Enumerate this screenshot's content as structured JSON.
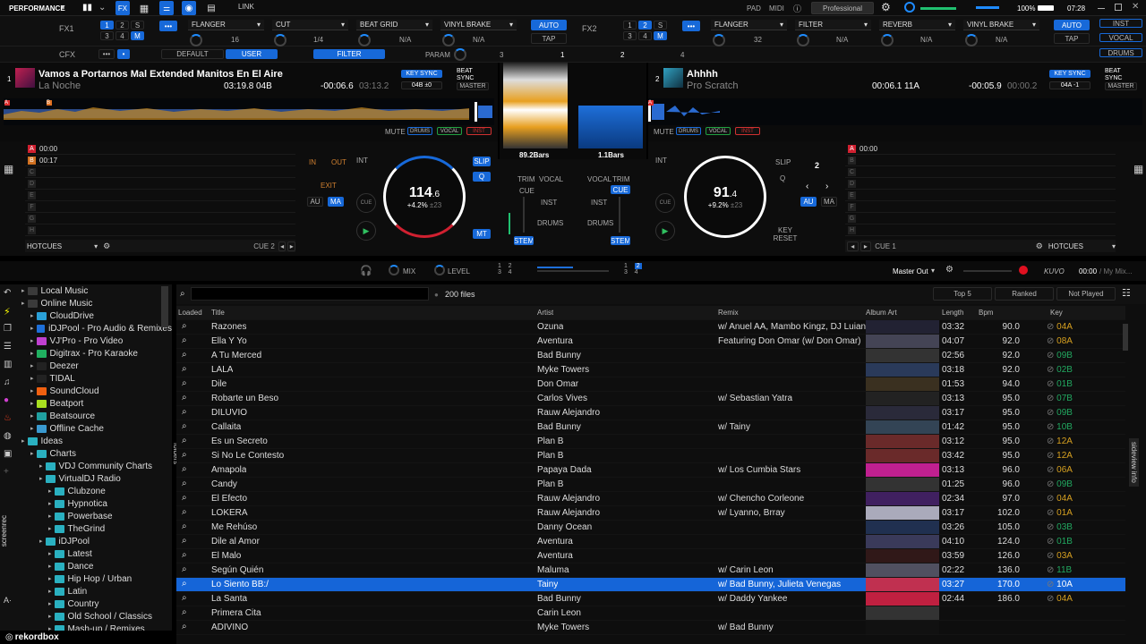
{
  "topbar": {
    "layout": "PERFORMANCE",
    "link": "LINK",
    "pad": "PAD",
    "midi": "MIDI",
    "license": "Professional",
    "volume": "100%",
    "time": "07:28"
  },
  "fx1": {
    "label": "FX1",
    "nums": [
      "1",
      "2",
      "S",
      "3",
      "4",
      "M"
    ],
    "effects": [
      "FLANGER",
      "CUT",
      "BEAT GRID",
      "VINYL BRAKE"
    ],
    "vals": [
      "16",
      "1/4",
      "N/A",
      "N/A"
    ],
    "auto": "AUTO",
    "tap": "TAP"
  },
  "fx2": {
    "label": "FX2",
    "nums": [
      "1",
      "2",
      "S",
      "3",
      "4",
      "M"
    ],
    "effects": [
      "FLANGER",
      "FILTER",
      "REVERB",
      "VINYL BRAKE"
    ],
    "vals": [
      "32",
      "N/A",
      "N/A",
      "N/A"
    ],
    "auto": "AUTO",
    "tap": "TAP"
  },
  "stems": [
    "INST",
    "VOCAL",
    "DRUMS"
  ],
  "cfx": {
    "label": "CFX",
    "default": "DEFAULT",
    "user": "USER",
    "filter": "FILTER",
    "param": "PARAM",
    "n1": "3",
    "n2": "1",
    "n3": "2",
    "n4": "4"
  },
  "deck1": {
    "num": "1",
    "title": "Vamos a Portarnos Mal Extended Manitos En El Aire",
    "artist": "La Noche",
    "time": "03:19.8",
    "key": "04B",
    "remain": "-00:06.6",
    "total": "03:13.2",
    "keysync": "KEY SYNC",
    "beatsync": "BEAT SYNC",
    "keyval": "04B ±0",
    "master": "MASTER",
    "mute": "MUTE",
    "drums": "DRUMS",
    "vocal": "VOCAL",
    "inst": "INST",
    "bpm": "114",
    "bpmdec": ".6",
    "pitch": "+4.2%",
    "range": "±23",
    "hotcues": [
      {
        "k": "A",
        "t": "00:00"
      },
      {
        "k": "B",
        "t": "00:17"
      },
      {
        "k": "C",
        "t": ""
      },
      {
        "k": "D",
        "t": ""
      },
      {
        "k": "E",
        "t": ""
      },
      {
        "k": "F",
        "t": ""
      },
      {
        "k": "G",
        "t": ""
      },
      {
        "k": "H",
        "t": ""
      }
    ],
    "hotcue_label": "HOTCUES",
    "cue2": "CUE 2",
    "int": "INT",
    "in": "IN",
    "out": "OUT",
    "exit": "EXIT",
    "au": "AU",
    "ma": "MA",
    "cue": "CUE",
    "slip": "SLIP",
    "q": "Q",
    "mt": "MT"
  },
  "deck2": {
    "num": "2",
    "title": "Ahhhh",
    "artist": "Pro Scratch",
    "time": "00:06.1",
    "key": "11A",
    "remain": "-00:05.9",
    "total": "00:00.2",
    "keysync": "KEY SYNC",
    "beatsync": "BEAT SYNC",
    "keyval": "04A -1",
    "master": "MASTER",
    "mute": "MUTE",
    "drums": "DRUMS",
    "vocal": "VOCAL",
    "inst": "INST",
    "bpm": "91",
    "bpmdec": ".4",
    "pitch": "+9.2%",
    "range": "±23",
    "hotcues": [
      {
        "k": "A",
        "t": "00:00"
      },
      {
        "k": "B",
        "t": ""
      },
      {
        "k": "C",
        "t": ""
      },
      {
        "k": "D",
        "t": ""
      },
      {
        "k": "E",
        "t": ""
      },
      {
        "k": "F",
        "t": ""
      },
      {
        "k": "G",
        "t": ""
      },
      {
        "k": "H",
        "t": ""
      }
    ],
    "hotcue_label": "HOTCUES",
    "cue1": "CUE 1",
    "int": "INT",
    "slip": "SLIP",
    "q": "Q",
    "two": "2",
    "au": "AU",
    "ma": "MA",
    "cue": "CUE",
    "keyreset": "KEY RESET"
  },
  "mixer": {
    "bars1": "89.2Bars",
    "bars2": "1.1Bars",
    "trim": "TRIM",
    "vocal": "VOCAL",
    "cue": "CUE",
    "inst": "INST",
    "drums": "DRUMS",
    "stem": "STEM"
  },
  "midbar": {
    "mix": "MIX",
    "level": "LEVEL",
    "master_out": "Master Out",
    "kuvo": "KUVO",
    "rec_time": "00:00",
    "mymix": "/ My Mix..."
  },
  "tree": [
    {
      "label": "Local Music",
      "lvl": 0,
      "c": "#3a3a3a"
    },
    {
      "label": "Online Music",
      "lvl": 0,
      "c": "#3a3a3a"
    },
    {
      "label": "CloudDrive",
      "lvl": 1,
      "c": "#2aa0d8"
    },
    {
      "label": "iDJPool - Pro Audio & Remixes",
      "lvl": 1,
      "c": "#1e6fd9"
    },
    {
      "label": "VJ'Pro - Pro Video",
      "lvl": 1,
      "c": "#c040d0"
    },
    {
      "label": "Digitrax - Pro Karaoke",
      "lvl": 1,
      "c": "#20b060"
    },
    {
      "label": "Deezer",
      "lvl": 1,
      "c": "#222"
    },
    {
      "label": "TIDAL",
      "lvl": 1,
      "c": "#222"
    },
    {
      "label": "SoundCloud",
      "lvl": 1,
      "c": "#f06010"
    },
    {
      "label": "Beatport",
      "lvl": 1,
      "c": "#a8e020"
    },
    {
      "label": "Beatsource",
      "lvl": 1,
      "c": "#20a0a0"
    },
    {
      "label": "Offline Cache",
      "lvl": 1,
      "c": "#3a9ad0"
    },
    {
      "label": "Ideas",
      "lvl": 0,
      "c": "#2ab0c0"
    },
    {
      "label": "Charts",
      "lvl": 1,
      "c": "#2ab0c0"
    },
    {
      "label": "VDJ Community Charts",
      "lvl": 2,
      "c": "#2ab0c0"
    },
    {
      "label": "VirtualDJ Radio",
      "lvl": 2,
      "c": "#2ab0c0"
    },
    {
      "label": "Clubzone",
      "lvl": 3,
      "c": "#2ab0c0"
    },
    {
      "label": "Hypnotica",
      "lvl": 3,
      "c": "#2ab0c0"
    },
    {
      "label": "Powerbase",
      "lvl": 3,
      "c": "#2ab0c0"
    },
    {
      "label": "TheGrind",
      "lvl": 3,
      "c": "#2ab0c0"
    },
    {
      "label": "iDJPool",
      "lvl": 2,
      "c": "#2ab0c0"
    },
    {
      "label": "Latest",
      "lvl": 3,
      "c": "#2ab0c0"
    },
    {
      "label": "Dance",
      "lvl": 3,
      "c": "#2ab0c0"
    },
    {
      "label": "Hip Hop / Urban",
      "lvl": 3,
      "c": "#2ab0c0"
    },
    {
      "label": "Latin",
      "lvl": 3,
      "c": "#2ab0c0"
    },
    {
      "label": "Country",
      "lvl": 3,
      "c": "#2ab0c0"
    },
    {
      "label": "Old School / Classics",
      "lvl": 3,
      "c": "#2ab0c0"
    },
    {
      "label": "Mash-up / Remixes",
      "lvl": 3,
      "c": "#2ab0c0"
    }
  ],
  "browser": {
    "files": "200 files",
    "top5": "Top 5",
    "ranked": "Ranked",
    "notplayed": "Not Played",
    "folders": "folders",
    "sideview": "sideview info",
    "cols": [
      "Loaded",
      "Title",
      "Artist",
      "Remix",
      "Album Art",
      "Length",
      "Bpm",
      "Key"
    ],
    "rows": [
      [
        "Razones",
        "Ozuna",
        "w/ Anuel AA, Mambo Kingz, DJ Luian",
        "03:32",
        "90.0",
        "04A"
      ],
      [
        "Ella Y Yo",
        "Aventura",
        "Featuring Don Omar (w/ Don Omar)",
        "04:07",
        "92.0",
        "08A"
      ],
      [
        "A Tu Merced",
        "Bad Bunny",
        "",
        "02:56",
        "92.0",
        "09B"
      ],
      [
        "LALA",
        "Myke Towers",
        "",
        "03:18",
        "92.0",
        "02B"
      ],
      [
        "Dile",
        "Don Omar",
        "",
        "01:53",
        "94.0",
        "01B"
      ],
      [
        "Robarte un Beso",
        "Carlos Vives",
        "w/ Sebastian Yatra",
        "03:13",
        "95.0",
        "07B"
      ],
      [
        "DILUVIO",
        "Rauw Alejandro",
        "",
        "03:17",
        "95.0",
        "09B"
      ],
      [
        "Callaita",
        "Bad Bunny",
        "w/ Tainy",
        "01:42",
        "95.0",
        "10B"
      ],
      [
        "Es un Secreto",
        "Plan B",
        "",
        "03:12",
        "95.0",
        "12A"
      ],
      [
        "Si No Le Contesto",
        "Plan B",
        "",
        "03:42",
        "95.0",
        "12A"
      ],
      [
        "Amapola",
        "Papaya Dada",
        "w/ Los Cumbia Stars",
        "03:13",
        "96.0",
        "06A"
      ],
      [
        "Candy",
        "Plan B",
        "",
        "01:25",
        "96.0",
        "09B"
      ],
      [
        "El Efecto",
        "Rauw Alejandro",
        "w/ Chencho Corleone",
        "02:34",
        "97.0",
        "04A"
      ],
      [
        "LOKERA",
        "Rauw Alejandro",
        "w/ Lyanno, Brray",
        "03:17",
        "102.0",
        "01A"
      ],
      [
        "Me Rehúso",
        "Danny Ocean",
        "",
        "03:26",
        "105.0",
        "03B"
      ],
      [
        "Dile al Amor",
        "Aventura",
        "",
        "04:10",
        "124.0",
        "01B"
      ],
      [
        "El Malo",
        "Aventura",
        "",
        "03:59",
        "126.0",
        "03A"
      ],
      [
        "Según Quién",
        "Maluma",
        "w/ Carin Leon",
        "02:22",
        "136.0",
        "11B"
      ],
      [
        "Lo Siento BB:/",
        "Tainy",
        "w/ Bad Bunny, Julieta Venegas",
        "03:27",
        "170.0",
        "10A"
      ],
      [
        "La Santa",
        "Bad Bunny",
        "w/ Daddy Yankee",
        "02:44",
        "186.0",
        "04A"
      ],
      [
        "Primera Cita",
        "Carin Leon",
        "",
        "",
        "",
        ""
      ],
      [
        "ADIVINO",
        "Myke Towers",
        "w/ Bad Bunny",
        "",
        "",
        ""
      ]
    ],
    "selected_index": 18,
    "keycolors": {
      "A": "#d6a020",
      "B": "#22a860"
    }
  },
  "footer": {
    "logo": "rekordbox",
    "screenrec": "screenrec"
  }
}
